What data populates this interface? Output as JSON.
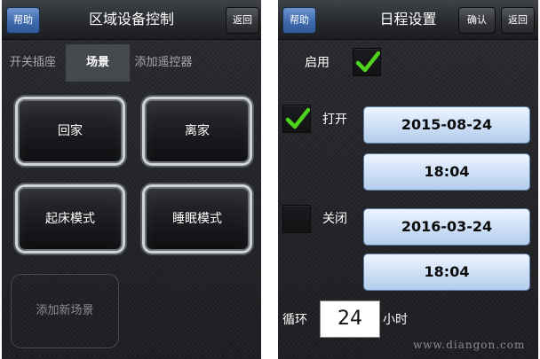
{
  "left_screen": {
    "help_label": "帮助",
    "title": "区域设备控制",
    "back_label": "返回",
    "tabs": [
      {
        "label": "开关插座",
        "active": false
      },
      {
        "label": "场景",
        "active": true
      },
      {
        "label": "添加遥控器",
        "active": false
      }
    ],
    "scenes": [
      {
        "label": "回家"
      },
      {
        "label": "离家"
      },
      {
        "label": "起床模式"
      },
      {
        "label": "睡眠模式"
      }
    ],
    "add_scene_label": "添加新场景"
  },
  "right_screen": {
    "help_label": "帮助",
    "title": "日程设置",
    "confirm_label": "确认",
    "back_label": "返回",
    "enable": {
      "label": "启用",
      "checked": true
    },
    "on": {
      "label": "打开",
      "checked": true,
      "date": "2015-08-24",
      "time": "18:04"
    },
    "off": {
      "label": "关闭",
      "checked": false,
      "date": "2016-03-24",
      "time": "18:04"
    },
    "cycle": {
      "label": "循环",
      "value": "24",
      "unit": "小时"
    },
    "watermark": "www.diangon.com"
  },
  "colors": {
    "accent_blue": "#3e6aad",
    "check_green": "#4fd21c",
    "value_button_blue": "#cfe1f7"
  },
  "icons": {
    "check": "check-icon"
  }
}
